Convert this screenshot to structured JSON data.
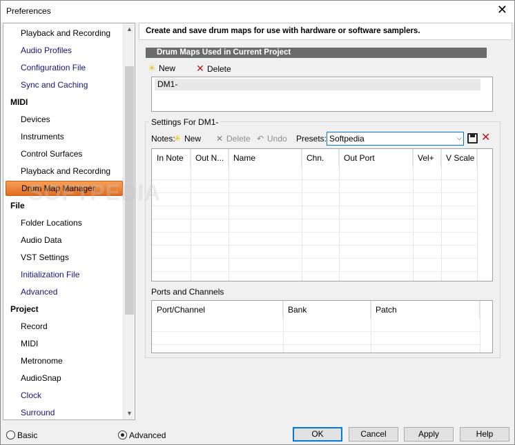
{
  "window": {
    "title": "Preferences",
    "close_glyph": "✕"
  },
  "sidebar": {
    "scroll_up": "▲",
    "scroll_down": "▼",
    "items": [
      {
        "label": "Playback and Recording",
        "kind": "sub"
      },
      {
        "label": "Audio Profiles",
        "kind": "sub-blue"
      },
      {
        "label": "Configuration File",
        "kind": "sub-blue"
      },
      {
        "label": "Sync and Caching",
        "kind": "sub-blue"
      },
      {
        "label": "MIDI",
        "kind": "cat"
      },
      {
        "label": "Devices",
        "kind": "sub"
      },
      {
        "label": "Instruments",
        "kind": "sub"
      },
      {
        "label": "Control Surfaces",
        "kind": "sub"
      },
      {
        "label": "Playback and Recording",
        "kind": "sub"
      },
      {
        "label": "Drum Map Manager",
        "kind": "selected"
      },
      {
        "label": "File",
        "kind": "cat"
      },
      {
        "label": "Folder Locations",
        "kind": "sub"
      },
      {
        "label": "Audio Data",
        "kind": "sub"
      },
      {
        "label": "VST Settings",
        "kind": "sub"
      },
      {
        "label": "Initialization File",
        "kind": "sub-blue"
      },
      {
        "label": "Advanced",
        "kind": "sub-blue"
      },
      {
        "label": "Project",
        "kind": "cat"
      },
      {
        "label": "Record",
        "kind": "sub"
      },
      {
        "label": "MIDI",
        "kind": "sub"
      },
      {
        "label": "Metronome",
        "kind": "sub"
      },
      {
        "label": "AudioSnap",
        "kind": "sub"
      },
      {
        "label": "Clock",
        "kind": "sub-blue"
      },
      {
        "label": "Surround",
        "kind": "sub-blue"
      }
    ]
  },
  "panel": {
    "description": "Create and save drum maps for use with hardware or software samplers.",
    "section_title": "Drum Maps Used in Current Project",
    "new_label": "New",
    "delete_label": "Delete",
    "maps": [
      "DM1-"
    ],
    "settings_group": "Settings For DM1-",
    "notes_label": "Notes:",
    "notes_new": "New",
    "notes_delete": "Delete",
    "notes_undo": "Undo",
    "presets_label": "Presets:",
    "presets_value": "Softpedia",
    "notes_columns": [
      "In Note",
      "Out N...",
      "Name",
      "Chn.",
      "Out Port",
      "Vel+",
      "V Scale"
    ],
    "ports_label": "Ports and Channels",
    "ports_columns": [
      "Port/Channel",
      "Bank",
      "Patch"
    ]
  },
  "footer": {
    "mode_basic": "Basic",
    "mode_advanced": "Advanced",
    "selected_mode": "Advanced",
    "ok": "OK",
    "cancel": "Cancel",
    "apply": "Apply",
    "help": "Help"
  },
  "watermark": "SOFTPEDIA",
  "colors": {
    "selected_item": "#f08a3c",
    "section_bar": "#6b6b6b",
    "link_blue": "#14147a",
    "delete_red": "#c01414"
  }
}
